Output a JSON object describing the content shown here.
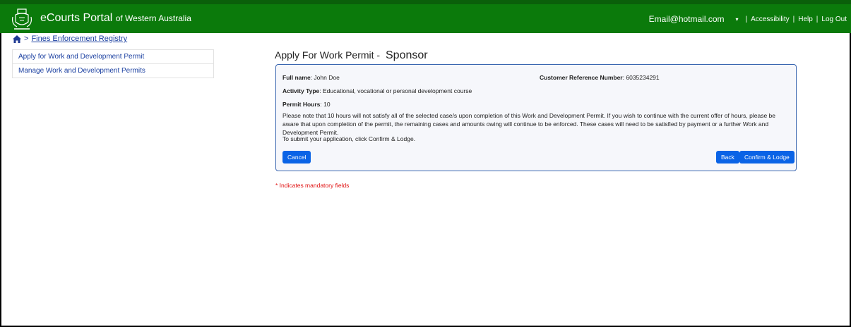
{
  "header": {
    "brand_main": "eCourts Portal",
    "brand_sub": "of Western Australia",
    "email": "Email@hotmail.com",
    "links": [
      "Accessibility",
      "Help",
      "Log Out"
    ]
  },
  "breadcrumb": {
    "arrow": ">",
    "link": "Fines Enforcement Registry"
  },
  "sidebar": {
    "items": [
      {
        "label": "Apply for Work and Development Permit"
      },
      {
        "label": "Manage Work and Development Permits"
      }
    ]
  },
  "main": {
    "title": "Apply For Work Permit -",
    "subtitle": "Sponsor",
    "full_name_label": "Full name",
    "full_name_value": "John Doe",
    "crn_label": "Customer Reference Number",
    "crn_value": "6035234291",
    "activity_label": "Activity Type",
    "activity_value": "Educational, vocational or personal development course",
    "hours_label": "Permit Hours",
    "hours_value": "10",
    "note": "Please note that 10 hours will not satisfy all of the selected case/s upon completion of this Work and Development Permit. If you wish to continue with the current offer of hours, please be aware that upon completion of the permit, the remaining cases and amounts owing will continue to be enforced. These cases will need to be satisfied by payment or a further Work and Development Permit.",
    "submit_text": "To submit your application, click Confirm & Lodge.",
    "cancel_label": "Cancel",
    "back_label": "Back",
    "confirm_label": "Confirm & Lodge",
    "mandatory_text": "* Indicates mandatory fields"
  },
  "colors": {
    "header_green": "#0b7a0b",
    "button_blue": "#0a63e6",
    "link_blue": "#1a3fa0",
    "mandatory_red": "#e01010"
  }
}
